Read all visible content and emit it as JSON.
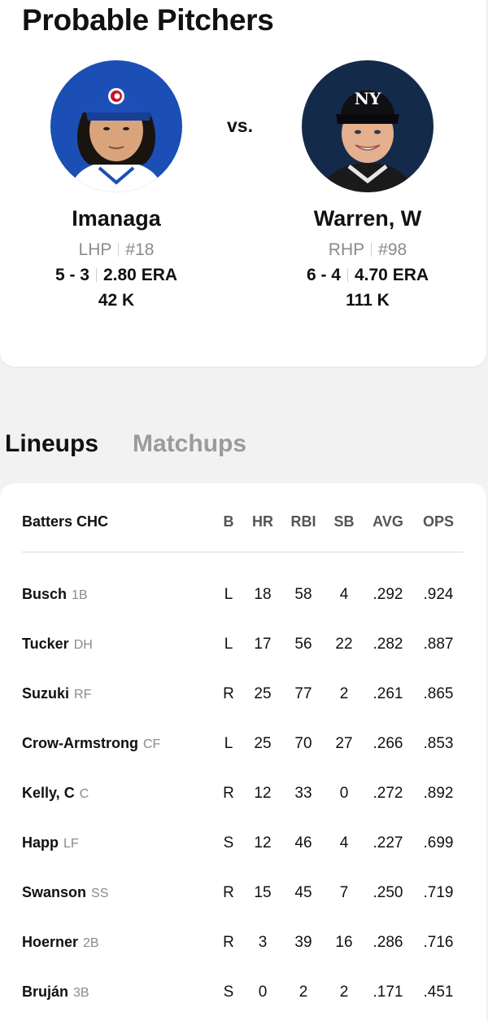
{
  "title": "Probable Pitchers",
  "vs": "vs.",
  "pitchers": [
    {
      "name": "Imanaga",
      "throws": "LHP",
      "number": "#18",
      "record": "5 - 3",
      "era": "2.80 ERA",
      "k": "42 K",
      "team_color": "#1b4fb5",
      "cap_logo": "C"
    },
    {
      "name": "Warren, W",
      "throws": "RHP",
      "number": "#98",
      "record": "6 - 4",
      "era": "4.70 ERA",
      "k": "111 K",
      "team_color": "#142a4a",
      "cap_logo": "NY"
    }
  ],
  "tabs": [
    {
      "label": "Lineups",
      "active": true
    },
    {
      "label": "Matchups",
      "active": false
    }
  ],
  "lineup": {
    "header": {
      "batters": "Batters CHC",
      "b": "B",
      "hr": "HR",
      "rbi": "RBI",
      "sb": "SB",
      "avg": "AVG",
      "ops": "OPS"
    },
    "rows": [
      {
        "name": "Busch",
        "pos": "1B",
        "b": "L",
        "hr": "18",
        "rbi": "58",
        "sb": "4",
        "avg": ".292",
        "ops": ".924"
      },
      {
        "name": "Tucker",
        "pos": "DH",
        "b": "L",
        "hr": "17",
        "rbi": "56",
        "sb": "22",
        "avg": ".282",
        "ops": ".887"
      },
      {
        "name": "Suzuki",
        "pos": "RF",
        "b": "R",
        "hr": "25",
        "rbi": "77",
        "sb": "2",
        "avg": ".261",
        "ops": ".865"
      },
      {
        "name": "Crow-Armstrong",
        "pos": "CF",
        "b": "L",
        "hr": "25",
        "rbi": "70",
        "sb": "27",
        "avg": ".266",
        "ops": ".853"
      },
      {
        "name": "Kelly, C",
        "pos": "C",
        "b": "R",
        "hr": "12",
        "rbi": "33",
        "sb": "0",
        "avg": ".272",
        "ops": ".892"
      },
      {
        "name": "Happ",
        "pos": "LF",
        "b": "S",
        "hr": "12",
        "rbi": "46",
        "sb": "4",
        "avg": ".227",
        "ops": ".699"
      },
      {
        "name": "Swanson",
        "pos": "SS",
        "b": "R",
        "hr": "15",
        "rbi": "45",
        "sb": "7",
        "avg": ".250",
        "ops": ".719"
      },
      {
        "name": "Hoerner",
        "pos": "2B",
        "b": "R",
        "hr": "3",
        "rbi": "39",
        "sb": "16",
        "avg": ".286",
        "ops": ".716"
      },
      {
        "name": "Bruján",
        "pos": "3B",
        "b": "S",
        "hr": "0",
        "rbi": "2",
        "sb": "2",
        "avg": ".171",
        "ops": ".451"
      }
    ]
  }
}
